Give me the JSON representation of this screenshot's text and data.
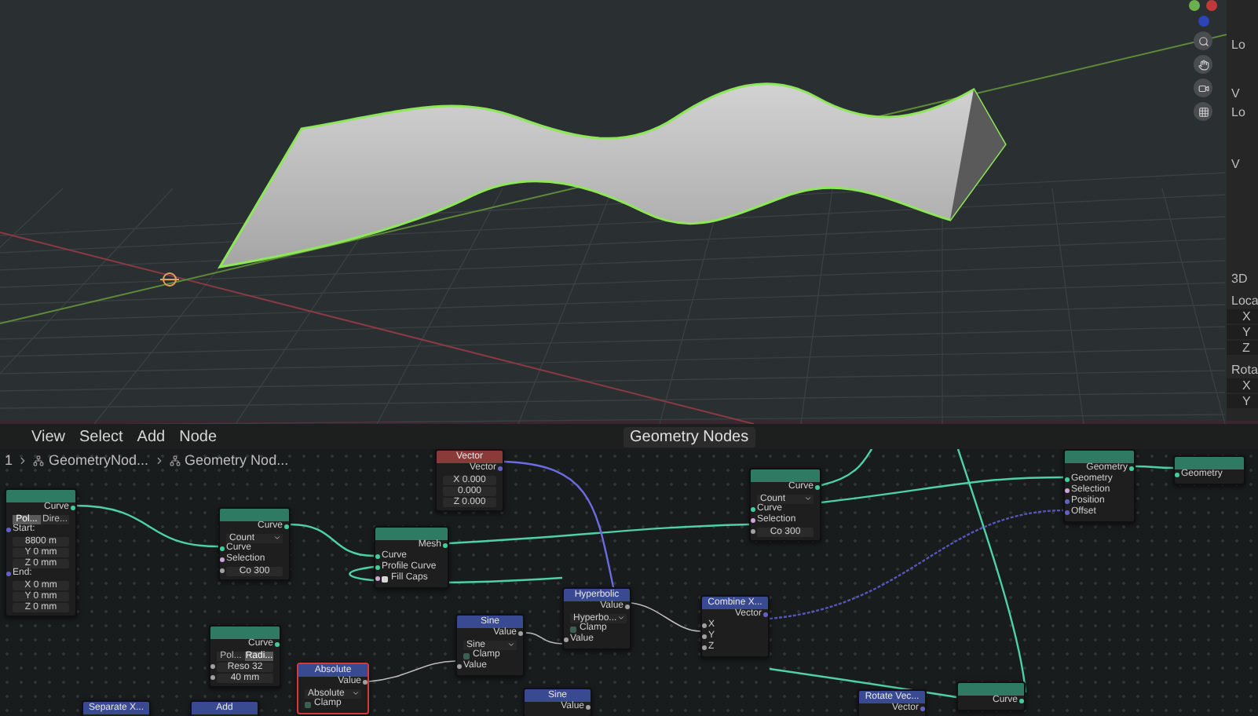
{
  "viewport": {
    "side_panel": [
      {
        "kind": "heading",
        "text": "Lo"
      },
      {
        "kind": "heading",
        "text": "V"
      },
      {
        "kind": "heading",
        "text": "Lo"
      },
      {
        "kind": "heading",
        "text": "V"
      },
      {
        "kind": "heading",
        "text": "3D"
      },
      {
        "kind": "heading",
        "text": "Loca"
      },
      {
        "kind": "axis",
        "text": "X"
      },
      {
        "kind": "axis",
        "text": "Y"
      },
      {
        "kind": "axis",
        "text": "Z"
      },
      {
        "kind": "heading",
        "text": "Rota"
      },
      {
        "kind": "axis",
        "text": "X"
      },
      {
        "kind": "axis",
        "text": "Y"
      }
    ]
  },
  "node_editor": {
    "menu": [
      "View",
      "Select",
      "Add",
      "Node"
    ],
    "tree_name": "Geometry Nodes",
    "breadcrumbs": [
      "1",
      "GeometryNod...",
      "Geometry Nod..."
    ],
    "nodes": [
      {
        "kind": "geometry",
        "selected": false,
        "rows": [
          {
            "kind": "out",
            "text": "Curve",
            "color": "#3fcf9b"
          },
          {
            "kind": "buttons",
            "options": [
              {
                "text": "Pol...",
                "selected": true
              },
              {
                "text": "Dire...",
                "selected": false
              }
            ]
          },
          {
            "kind": "in",
            "text": "Start:",
            "color": "#6363c7"
          },
          {
            "kind": "field",
            "text": "8800 m"
          },
          {
            "kind": "field",
            "text": "Y   0 mm"
          },
          {
            "kind": "field",
            "text": "Z   0 mm"
          },
          {
            "kind": "in",
            "text": "End:",
            "color": "#6363c7"
          },
          {
            "kind": "field",
            "text": "X   0 mm"
          },
          {
            "kind": "field",
            "text": "Y   0 mm"
          },
          {
            "kind": "field",
            "text": "Z   0 mm"
          }
        ]
      },
      {
        "kind": "geometry",
        "selected": false,
        "rows": [
          {
            "kind": "out",
            "text": "Curve",
            "color": "#3fcf9b"
          },
          {
            "kind": "dropdown",
            "text": "Count"
          },
          {
            "kind": "in",
            "text": "Curve",
            "color": "#3fcf9b"
          },
          {
            "kind": "in",
            "text": "Selection",
            "color": "#cca6d6"
          },
          {
            "kind": "field",
            "text": "Co   300",
            "color": "#a1a1a1"
          }
        ]
      },
      {
        "kind": "geometry",
        "selected": false,
        "rows": [
          {
            "kind": "out",
            "text": "Mesh",
            "color": "#3fcf9b"
          },
          {
            "kind": "in",
            "text": "Curve",
            "color": "#3fcf9b"
          },
          {
            "kind": "in",
            "text": "Profile Curve",
            "color": "#3fcf9b"
          },
          {
            "kind": "check",
            "text": "Fill Caps",
            "checked": true,
            "color": "#cca6d6"
          }
        ]
      },
      {
        "kind": "input",
        "title": "Vector",
        "selected": false,
        "rows": [
          {
            "kind": "out",
            "text": "Vector",
            "color": "#6363c7"
          },
          {
            "kind": "field",
            "text": "X  0.000"
          },
          {
            "kind": "field",
            "text": "0.000"
          },
          {
            "kind": "field",
            "text": "Z  0.000"
          }
        ]
      },
      {
        "kind": "geometry",
        "selected": false,
        "rows": [
          {
            "kind": "out",
            "text": "Curve",
            "color": "#3fcf9b"
          },
          {
            "kind": "dropdown",
            "text": "Count"
          },
          {
            "kind": "in",
            "text": "Curve",
            "color": "#3fcf9b"
          },
          {
            "kind": "in",
            "text": "Selection",
            "color": "#cca6d6"
          },
          {
            "kind": "field",
            "text": "Co   300",
            "color": "#a1a1a1"
          }
        ]
      },
      {
        "kind": "geometry",
        "selected": false,
        "rows": [
          {
            "kind": "out",
            "text": "Geometry",
            "color": "#3fcf9b"
          },
          {
            "kind": "in",
            "text": "Geometry",
            "color": "#3fcf9b"
          },
          {
            "kind": "in",
            "text": "Selection",
            "color": "#cca6d6"
          },
          {
            "kind": "in",
            "text": "Position",
            "color": "#6363c7"
          },
          {
            "kind": "in",
            "text": "Offset",
            "color": "#6363c7"
          }
        ]
      },
      {
        "kind": "output",
        "selected": false,
        "rows": [
          {
            "kind": "in",
            "text": "Geometry",
            "color": "#3fcf9b"
          }
        ]
      },
      {
        "kind": "geometry",
        "selected": false,
        "rows": [
          {
            "kind": "out",
            "text": "Curve",
            "color": "#3fcf9b"
          },
          {
            "kind": "buttons",
            "options": [
              {
                "text": "Pol...",
                "selected": false
              },
              {
                "text": "Radi...",
                "selected": true
              }
            ]
          },
          {
            "kind": "field",
            "text": "Reso  32",
            "color": "#a1a1a1"
          },
          {
            "kind": "field",
            "text": "40 mm",
            "color": "#a1a1a1"
          }
        ]
      },
      {
        "kind": "math",
        "title": "Absolute",
        "selected": true,
        "rows": [
          {
            "kind": "out",
            "text": "Value",
            "color": "#a1a1a1"
          },
          {
            "kind": "dropdown",
            "text": "Absolute"
          },
          {
            "kind": "check",
            "text": "Clamp",
            "checked": false
          }
        ]
      },
      {
        "kind": "math",
        "title": "Sine",
        "selected": false,
        "rows": [
          {
            "kind": "out",
            "text": "Value",
            "color": "#a1a1a1"
          },
          {
            "kind": "dropdown",
            "text": "Sine"
          },
          {
            "kind": "check",
            "text": "Clamp",
            "checked": false
          },
          {
            "kind": "in",
            "text": "Value",
            "color": "#a1a1a1"
          }
        ]
      },
      {
        "kind": "math",
        "title": "Hyperbolic",
        "selected": false,
        "rows": [
          {
            "kind": "out",
            "text": "Value",
            "color": "#a1a1a1"
          },
          {
            "kind": "dropdown",
            "text": "Hyperbo..."
          },
          {
            "kind": "check",
            "text": "Clamp",
            "checked": false
          },
          {
            "kind": "in",
            "text": "Value",
            "color": "#a1a1a1"
          }
        ]
      },
      {
        "kind": "math",
        "title": "Combine X...",
        "selected": false,
        "rows": [
          {
            "kind": "out",
            "text": "Vector",
            "color": "#6363c7"
          },
          {
            "kind": "in",
            "text": "X",
            "color": "#a1a1a1"
          },
          {
            "kind": "in",
            "text": "Y",
            "color": "#a1a1a1"
          },
          {
            "kind": "in",
            "text": "Z",
            "color": "#a1a1a1"
          }
        ]
      },
      {
        "kind": "math",
        "title": "Separate X...",
        "selected": false
      },
      {
        "kind": "math",
        "title": "Add",
        "selected": false
      },
      {
        "kind": "math",
        "title": "Sine",
        "selected": false,
        "rows": [
          {
            "kind": "out",
            "text": "Value",
            "color": "#a1a1a1"
          }
        ]
      },
      {
        "kind": "math",
        "title": "Rotate Vec...",
        "selected": false,
        "rows": [
          {
            "kind": "out",
            "text": "Vector",
            "color": "#6363c7"
          }
        ]
      },
      {
        "kind": "geometry",
        "selected": false,
        "rows": [
          {
            "kind": "out",
            "text": "Curve",
            "color": "#3fcf9b"
          }
        ]
      }
    ]
  }
}
